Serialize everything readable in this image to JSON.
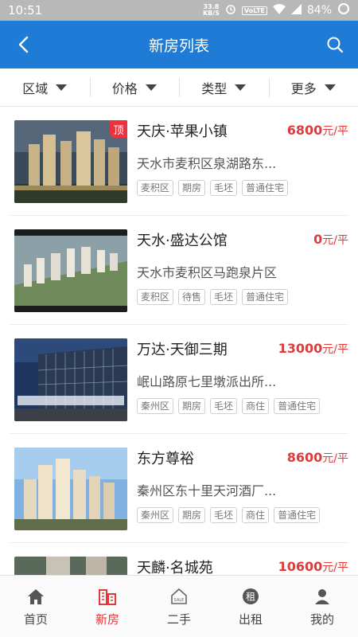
{
  "status_bar": {
    "time": "10:51",
    "speed_value": "33.8",
    "speed_unit": "KB/S",
    "network_badge": "VoLTE",
    "battery": "84%"
  },
  "header": {
    "title": "新房列表",
    "back_icon": "back-arrow-icon",
    "search_icon": "search-icon"
  },
  "filters": [
    {
      "label": "区域"
    },
    {
      "label": "价格"
    },
    {
      "label": "类型"
    },
    {
      "label": "更多"
    }
  ],
  "listings": [
    {
      "name": "天庆·苹果小镇",
      "price": "6800",
      "unit": "元/平",
      "address": "天水市麦积区泉湖路东...",
      "badge": "顶",
      "tags": [
        "麦积区",
        "期房",
        "毛坯",
        "普通住宅"
      ]
    },
    {
      "name": "天水·盛达公馆",
      "price": "0",
      "unit": "元/平",
      "address": "天水市麦积区马跑泉片区",
      "badge": "",
      "tags": [
        "麦积区",
        "待售",
        "毛坯",
        "普通住宅"
      ]
    },
    {
      "name": "万达·天御三期",
      "price": "13000",
      "unit": "元/平",
      "address": "岷山路原七里墩派出所...",
      "badge": "",
      "tags": [
        "秦州区",
        "期房",
        "毛坯",
        "商住",
        "普通住宅"
      ]
    },
    {
      "name": "东方尊裕",
      "price": "8600",
      "unit": "元/平",
      "address": "秦州区东十里天河酒厂...",
      "badge": "",
      "tags": [
        "秦州区",
        "期房",
        "毛坯",
        "商住",
        "普通住宅"
      ]
    },
    {
      "name": "天麟·名城苑",
      "price": "10600",
      "unit": "元/平",
      "address": "",
      "badge": "",
      "tags": []
    }
  ],
  "bottom_nav": [
    {
      "label": "首页",
      "icon": "home-icon"
    },
    {
      "label": "新房",
      "icon": "building-icon"
    },
    {
      "label": "二手",
      "icon": "house-sale-icon"
    },
    {
      "label": "出租",
      "icon": "rent-icon"
    },
    {
      "label": "我的",
      "icon": "user-icon"
    }
  ],
  "colors": {
    "primary": "#1f7cd6",
    "accent": "#e03a3a",
    "status_bar": "#b8b8b8"
  }
}
